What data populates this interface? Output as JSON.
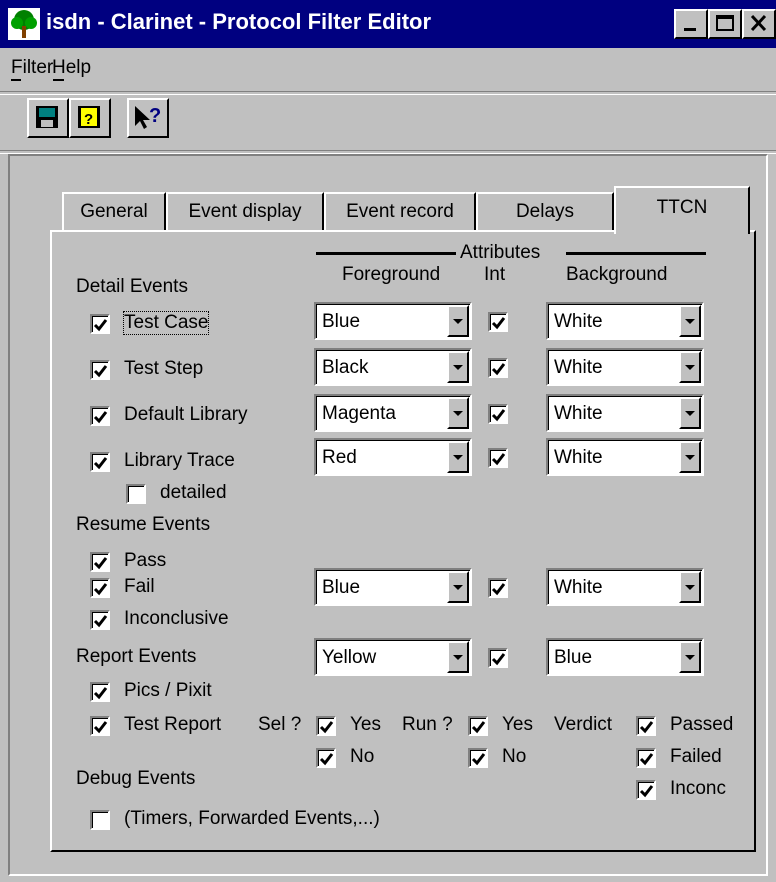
{
  "window": {
    "title": "isdn - Clarinet - Protocol Filter Editor"
  },
  "menu": {
    "filter": "Filter",
    "help": "Help"
  },
  "toolbar": {
    "save": "save-icon",
    "save_help": "help-book-icon",
    "context_help": "whats-this-icon"
  },
  "tabs": [
    {
      "label": "General",
      "active": false
    },
    {
      "label": "Event display",
      "active": false
    },
    {
      "label": "Event record",
      "active": false
    },
    {
      "label": "Delays",
      "active": false
    },
    {
      "label": "TTCN",
      "active": true
    }
  ],
  "headers": {
    "attributes": "Attributes",
    "foreground": "Foreground",
    "int": "Int",
    "background": "Background"
  },
  "detail": {
    "title": "Detail Events",
    "rows": [
      {
        "label": "Test Case",
        "checked": true,
        "fg": "Blue",
        "int": true,
        "bg": "White"
      },
      {
        "label": "Test Step",
        "checked": true,
        "fg": "Black",
        "int": true,
        "bg": "White"
      },
      {
        "label": "Default Library",
        "checked": true,
        "fg": "Magenta",
        "int": true,
        "bg": "White"
      },
      {
        "label": "Library Trace",
        "checked": true,
        "fg": "Red",
        "int": true,
        "bg": "White"
      }
    ],
    "detailed": {
      "label": "detailed",
      "checked": false
    }
  },
  "resume": {
    "title": "Resume Events",
    "pass": "Pass",
    "fail": "Fail",
    "inconclusive": "Inconclusive",
    "fg": "Blue",
    "bg": "White"
  },
  "report": {
    "title": "Report Events",
    "fg": "Yellow",
    "bg": "Blue",
    "pics": "Pics / Pixit",
    "test_report": "Test Report",
    "sel_label": "Sel ?",
    "run_label": "Run ?",
    "verdict_label": "Verdict",
    "yes": "Yes",
    "no": "No",
    "passed": "Passed",
    "failed": "Failed",
    "inconc": "Inconc"
  },
  "debug": {
    "title": "Debug Events",
    "label": "(Timers, Forwarded Events,...)",
    "checked": false
  }
}
